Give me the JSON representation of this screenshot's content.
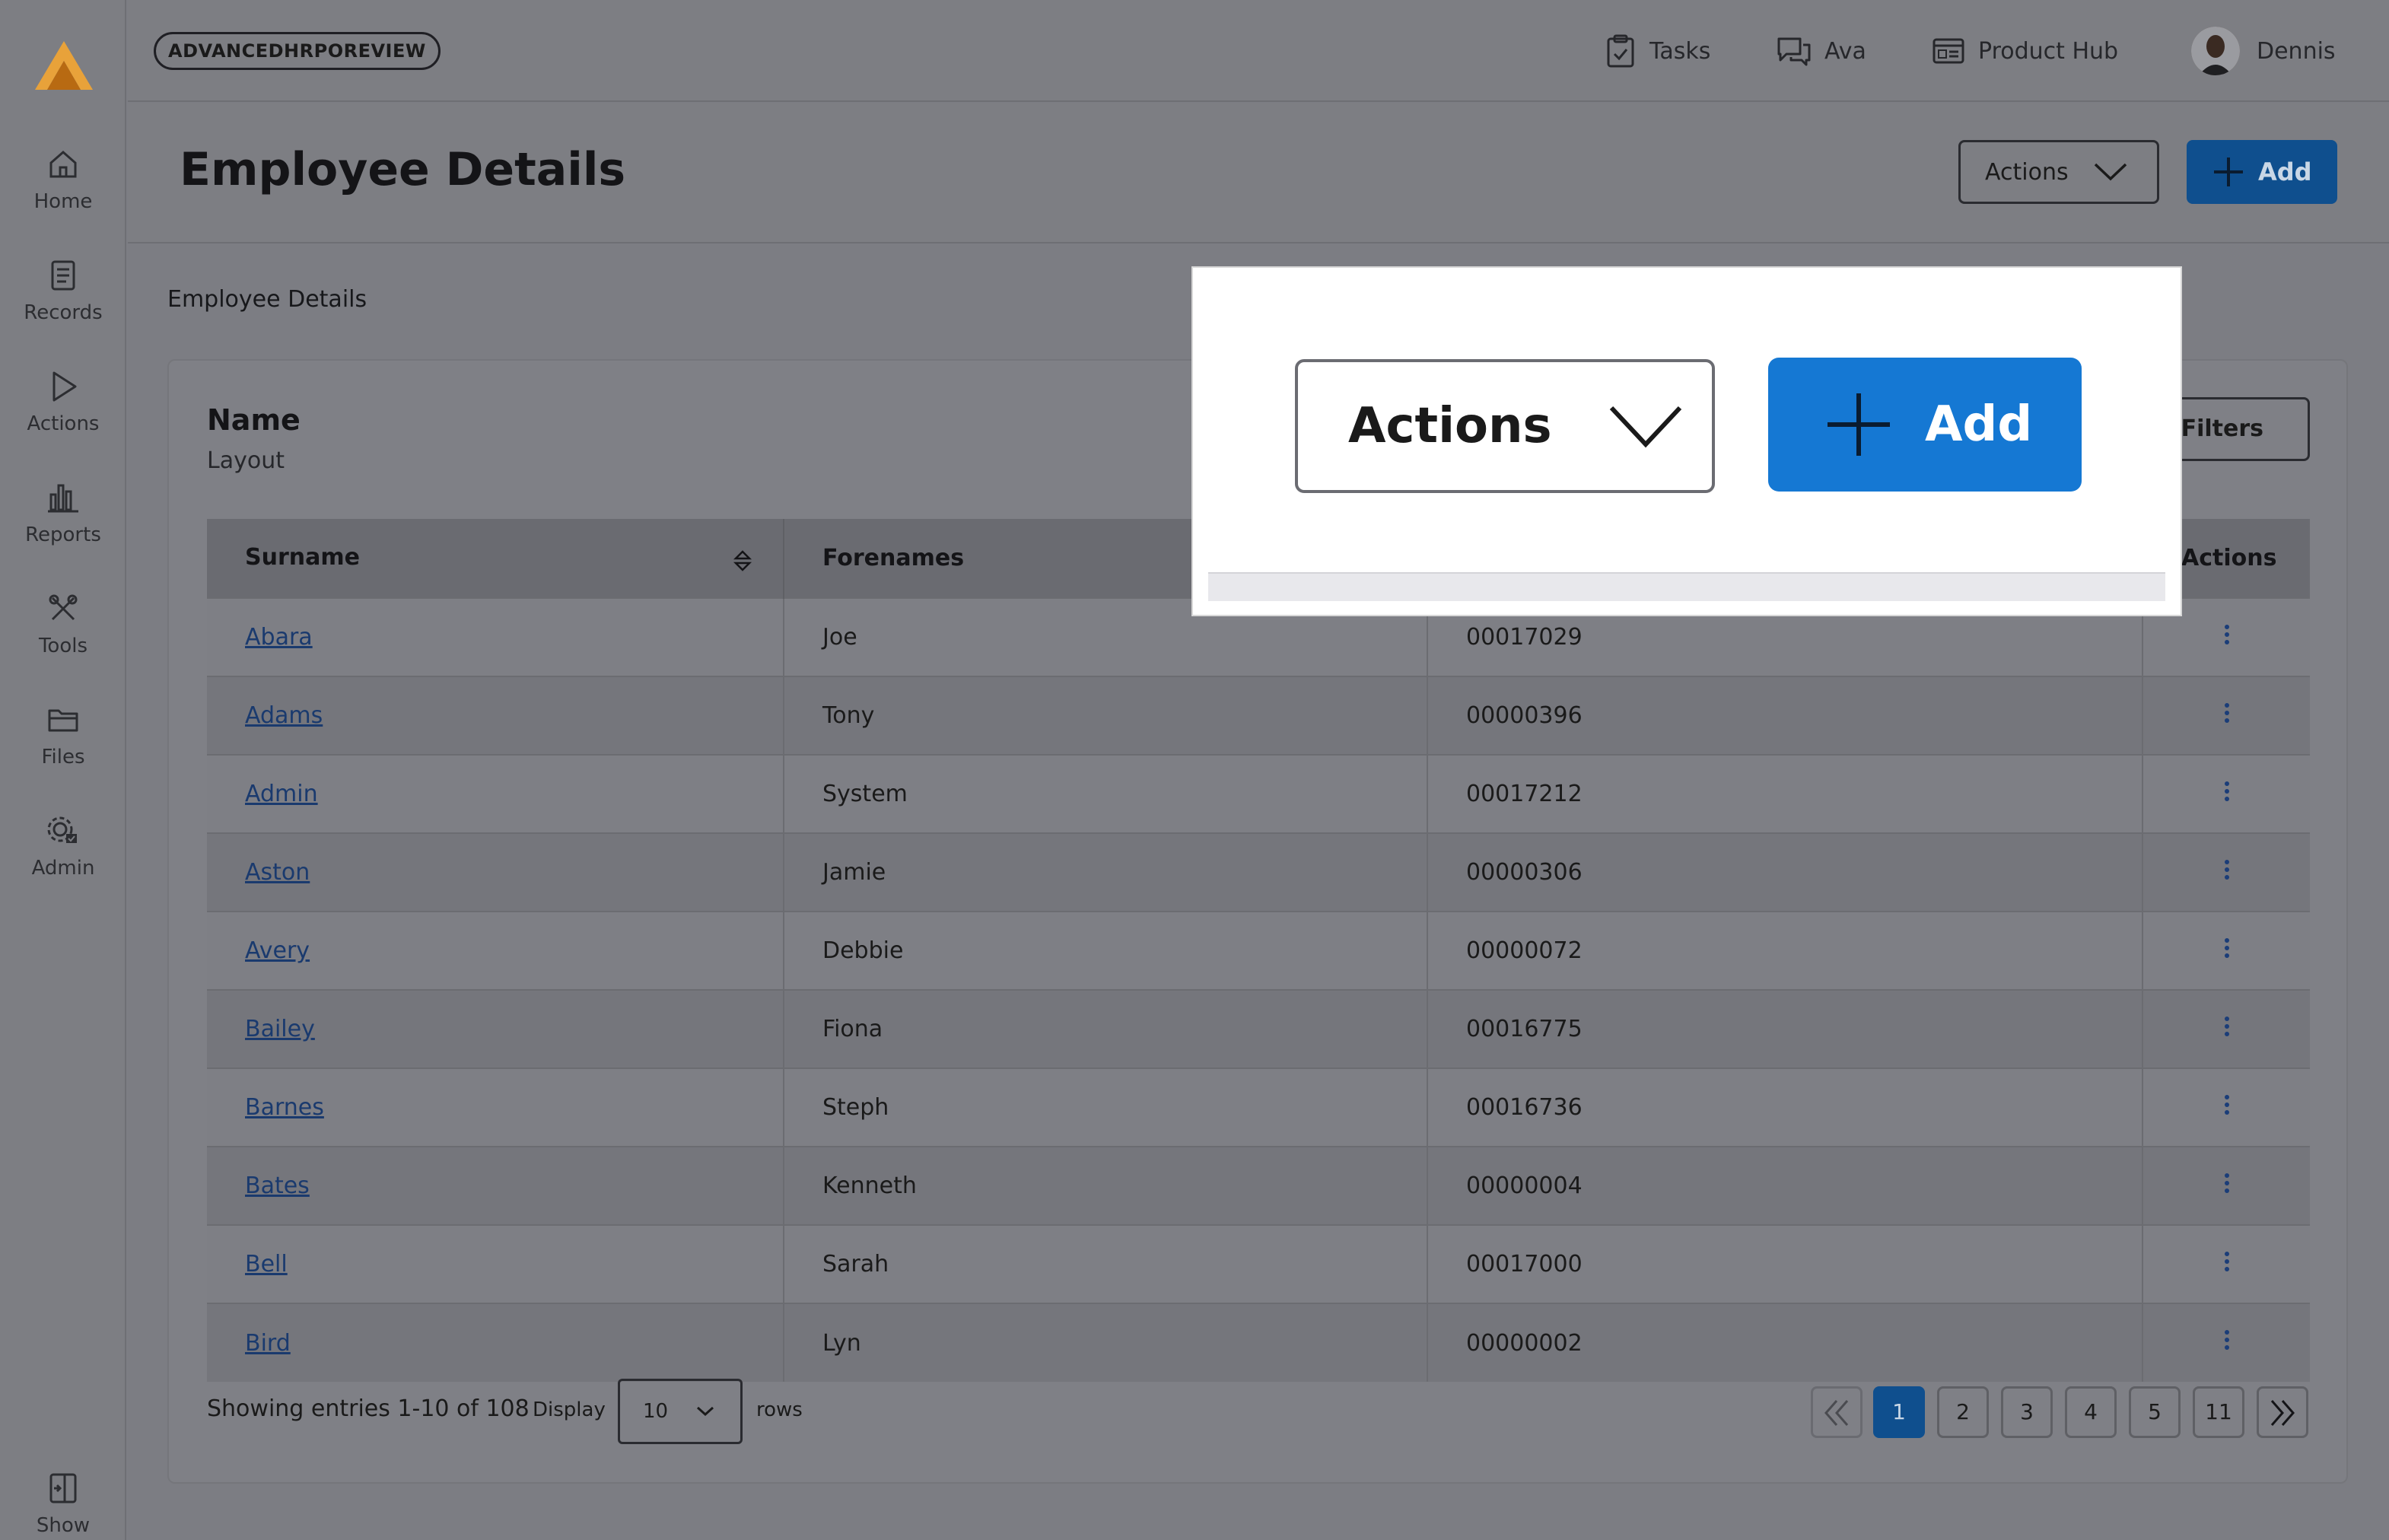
{
  "env_badge": "ADVANCEDHRPOREVIEW",
  "topbar": {
    "tasks": "Tasks",
    "ava": "Ava",
    "product_hub": "Product Hub",
    "user": "Dennis"
  },
  "sidebar": {
    "items": [
      {
        "label": "Home",
        "icon": "home-icon"
      },
      {
        "label": "Records",
        "icon": "records-icon"
      },
      {
        "label": "Actions",
        "icon": "play-icon"
      },
      {
        "label": "Reports",
        "icon": "bar-chart-icon"
      },
      {
        "label": "Tools",
        "icon": "tools-icon"
      },
      {
        "label": "Files",
        "icon": "folder-icon"
      },
      {
        "label": "Admin",
        "icon": "gear-check-icon"
      }
    ],
    "show_label": "Show"
  },
  "header": {
    "title": "Employee Details",
    "actions_label": "Actions",
    "add_label": "Add"
  },
  "breadcrumb": "Employee Details",
  "panel": {
    "title": "Name",
    "subtitle": "Layout",
    "filters_label": "Filters"
  },
  "table": {
    "columns": [
      "Surname",
      "Forenames",
      "",
      "Actions"
    ],
    "rows": [
      {
        "surname": "Abara",
        "forenames": "Joe",
        "number": "00017029"
      },
      {
        "surname": "Adams",
        "forenames": "Tony",
        "number": "00000396"
      },
      {
        "surname": "Admin",
        "forenames": "System",
        "number": "00017212"
      },
      {
        "surname": "Aston",
        "forenames": "Jamie",
        "number": "00000306"
      },
      {
        "surname": "Avery",
        "forenames": "Debbie",
        "number": "00000072"
      },
      {
        "surname": "Bailey",
        "forenames": "Fiona",
        "number": "00016775"
      },
      {
        "surname": "Barnes",
        "forenames": "Steph",
        "number": "00016736"
      },
      {
        "surname": "Bates",
        "forenames": "Kenneth",
        "number": "00000004"
      },
      {
        "surname": "Bell",
        "forenames": "Sarah",
        "number": "00017000"
      },
      {
        "surname": "Bird",
        "forenames": "Lyn",
        "number": "00000002"
      }
    ]
  },
  "footer": {
    "showing": "Showing entries 1-10 of 108",
    "display_label": "Display",
    "display_value": "10",
    "rows_label": "rows",
    "pages": [
      "1",
      "2",
      "3",
      "4",
      "5",
      "11"
    ],
    "active_page": "1"
  },
  "zoom": {
    "actions_label": "Actions",
    "add_label": "Add"
  },
  "colors": {
    "primary_blue": "#1578d3",
    "logo_orange": "#e8a23a"
  }
}
